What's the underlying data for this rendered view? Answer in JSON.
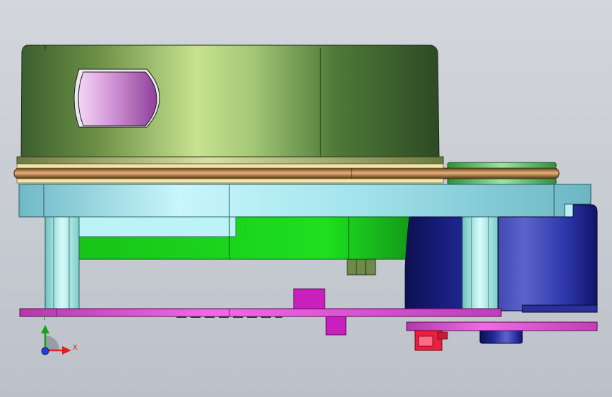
{
  "viewport": {
    "title": "",
    "background_top": "#d3d6dc",
    "background_bottom": "#bcc1c9"
  },
  "triad": {
    "x_label": "X",
    "y_label": "Y",
    "x_color": "#e02020",
    "y_color": "#18a018",
    "z_color": "#1f3fd8"
  },
  "colors": {
    "housing": "#6f9a4f",
    "window": "#c07ac8",
    "belt": "#a8703a",
    "plate": "#9fe0ea",
    "board": "#16d818",
    "motor": "#1a1f80",
    "pcb": "#d84ad0",
    "connector": "#e8203e"
  },
  "parts": [
    "housing-cylinder-part",
    "housing-window-part",
    "drive-belt-part",
    "pulley-part",
    "base-plate-part",
    "standoff-left-part",
    "standoff-right-part",
    "green-board-part",
    "motor-part",
    "pcb-part",
    "connector-part"
  ]
}
